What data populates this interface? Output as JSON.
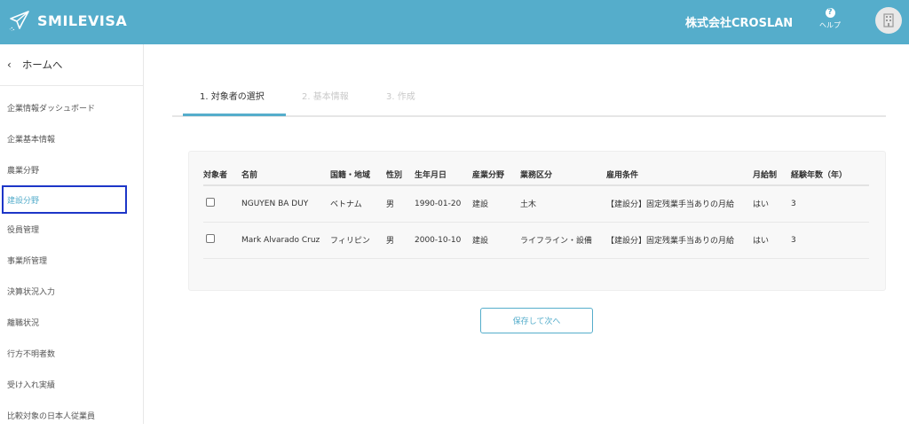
{
  "header": {
    "logo_text": "SMILEVISA",
    "company": "株式会社CROSLAN",
    "help_icon_glyph": "?",
    "help_label": "ヘルプ",
    "accent_color": "#55adcb"
  },
  "sidebar": {
    "home_chevron": "‹",
    "home_label": "ホームへ",
    "items": [
      {
        "label": "企業情報ダッシュボード"
      },
      {
        "label": "企業基本情報"
      },
      {
        "label": "農業分野"
      },
      {
        "label": "建設分野",
        "active": true
      },
      {
        "label": "役員管理"
      },
      {
        "label": "事業所管理"
      },
      {
        "label": "決算状況入力"
      },
      {
        "label": "離職状況"
      },
      {
        "label": "行方不明者数"
      },
      {
        "label": "受け入れ実績"
      },
      {
        "label": "比較対象の日本人従業員"
      }
    ]
  },
  "steps": [
    {
      "label": "1. 対象者の選択",
      "active": true
    },
    {
      "label": "2. 基本情報",
      "active": false
    },
    {
      "label": "3. 作成",
      "active": false
    }
  ],
  "table": {
    "headers": [
      "対象者",
      "名前",
      "国籍・地域",
      "性別",
      "生年月日",
      "産業分野",
      "業務区分",
      "雇用条件",
      "月給制",
      "経験年数（年）"
    ],
    "rows": [
      {
        "name": "NGUYEN BA DUY",
        "nationality": "ベトナム",
        "gender": "男",
        "birthdate": "1990-01-20",
        "industry": "建設",
        "category": "土木",
        "employment": "【建設分】固定残業手当ありの月給",
        "monthly": "はい",
        "years": "3",
        "checked": false
      },
      {
        "name": "Mark Alvarado Cruz",
        "nationality": "フィリピン",
        "gender": "男",
        "birthdate": "2000-10-10",
        "industry": "建設",
        "category": "ライフライン・設備",
        "employment": "【建設分】固定残業手当ありの月給",
        "monthly": "はい",
        "years": "3",
        "checked": false
      }
    ]
  },
  "actions": {
    "save_next": "保存して次へ"
  }
}
